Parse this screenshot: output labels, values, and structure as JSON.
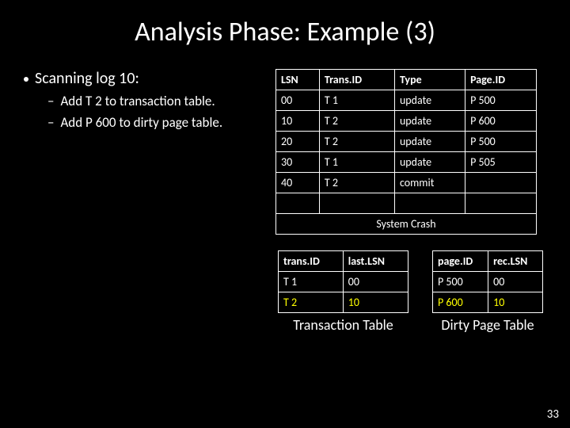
{
  "title": "Analysis Phase: Example (3)",
  "scan": {
    "heading": "Scanning log 10:",
    "sub1": "Add T 2 to transaction table.",
    "sub2": "Add P 600 to dirty page table."
  },
  "log": {
    "h1": "LSN",
    "h2": "Trans.ID",
    "h3": "Type",
    "h4": "Page.ID",
    "r0": {
      "c1": "00",
      "c2": "T 1",
      "c3": "update",
      "c4": "P 500"
    },
    "r1": {
      "c1": "10",
      "c2": "T 2",
      "c3": "update",
      "c4": "P 600"
    },
    "r2": {
      "c1": "20",
      "c2": "T 2",
      "c3": "update",
      "c4": "P 500"
    },
    "r3": {
      "c1": "30",
      "c2": "T 1",
      "c3": "update",
      "c4": "P 505"
    },
    "r4": {
      "c1": "40",
      "c2": "T 2",
      "c3": "commit",
      "c4": ""
    },
    "crash": "System Crash"
  },
  "ttable": {
    "h1": "trans.ID",
    "h2": "last.LSN",
    "r0": {
      "c1": "T 1",
      "c2": "00"
    },
    "r1": {
      "c1": "T 2",
      "c2": "10"
    },
    "caption": "Transaction Table"
  },
  "dtable": {
    "h1": "page.ID",
    "h2": "rec.LSN",
    "r0": {
      "c1": "P 500",
      "c2": "00"
    },
    "r1": {
      "c1": "P 600",
      "c2": "10"
    },
    "caption": "Dirty Page Table"
  },
  "pagenum": "33"
}
